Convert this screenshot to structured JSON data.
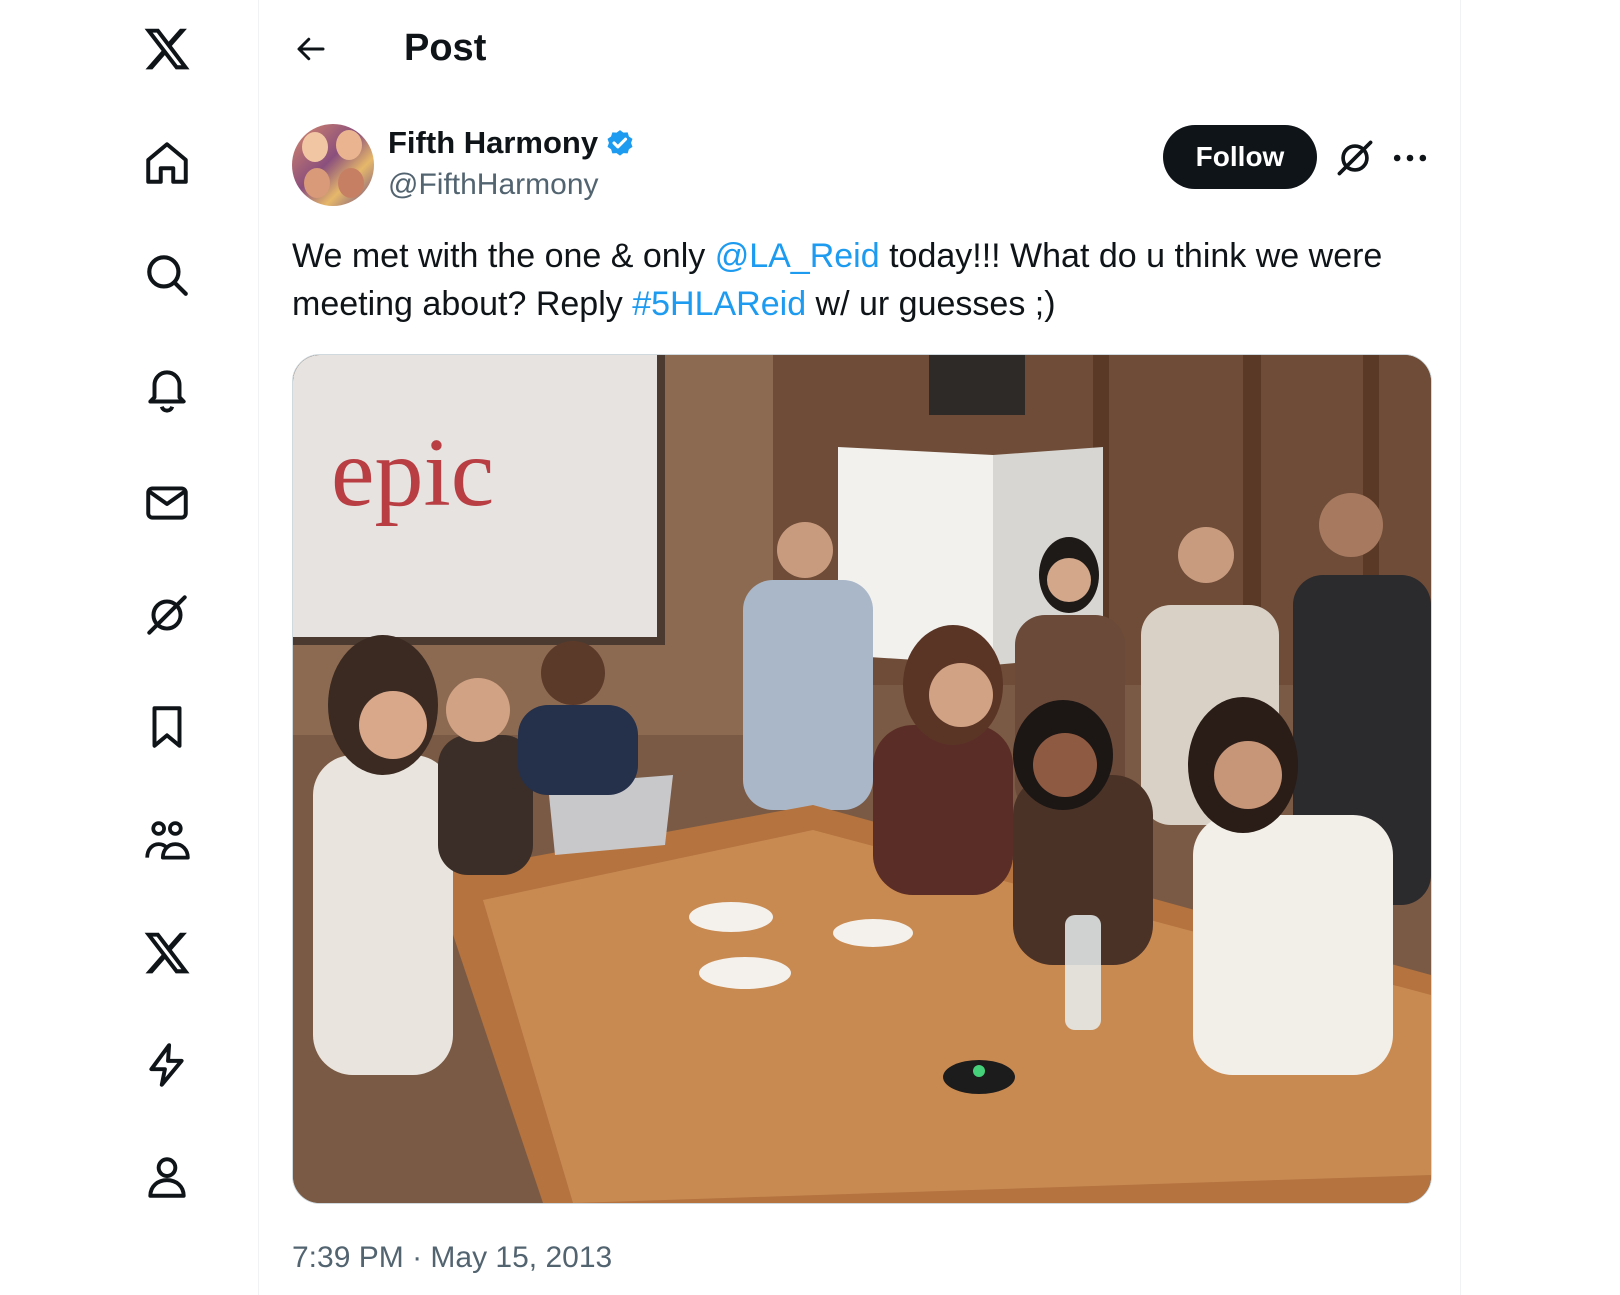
{
  "header": {
    "title": "Post"
  },
  "nav": {
    "items": [
      {
        "name": "x-logo-icon"
      },
      {
        "name": "home-icon"
      },
      {
        "name": "search-icon"
      },
      {
        "name": "notifications-icon"
      },
      {
        "name": "messages-icon"
      },
      {
        "name": "grok-icon"
      },
      {
        "name": "bookmarks-icon"
      },
      {
        "name": "communities-icon"
      },
      {
        "name": "premium-icon"
      },
      {
        "name": "verified-orgs-icon"
      },
      {
        "name": "profile-icon"
      }
    ]
  },
  "post": {
    "author": {
      "display_name": "Fifth Harmony",
      "handle": "@FifthHarmony",
      "verified": true
    },
    "follow_label": "Follow",
    "text": {
      "part1": "We met with the one & only ",
      "mention": "@LA_Reid",
      "part2": " today!!! What do u think we were meeting about? Reply ",
      "hashtag": "#5HLAReid",
      "part3": " w/ ur guesses ;)"
    },
    "media": {
      "screen_text": "epic"
    },
    "time": "7:39 PM",
    "separator": " · ",
    "date": "May 15, 2013"
  },
  "colors": {
    "text": "#0f1419",
    "secondary": "#536471",
    "link": "#1d9bf0",
    "follow_bg": "#0f1419"
  }
}
